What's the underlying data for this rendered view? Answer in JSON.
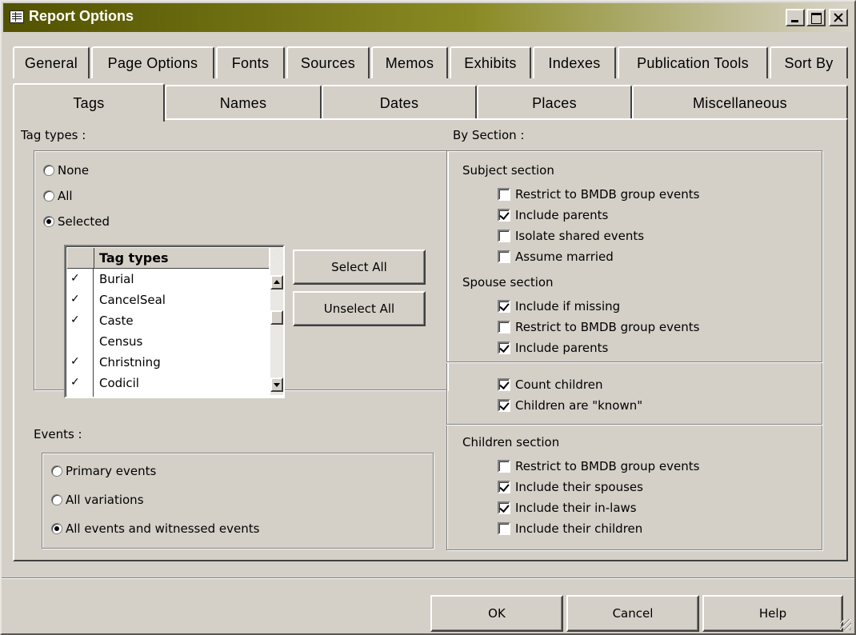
{
  "window": {
    "title": "Report Options",
    "icons": [
      "report-icon",
      "minimize-icon",
      "maximize-icon",
      "close-icon"
    ]
  },
  "tabs_row1": [
    "General",
    "Page Options",
    "Fonts",
    "Sources",
    "Memos",
    "Exhibits",
    "Indexes",
    "Publication Tools",
    "Sort By"
  ],
  "tabs_row2": [
    "Tags",
    "Names",
    "Dates",
    "Places",
    "Miscellaneous"
  ],
  "active_tab": "Tags",
  "tag_types": {
    "label": "Tag types :",
    "radios": [
      {
        "label": "None",
        "selected": false
      },
      {
        "label": "All",
        "selected": false
      },
      {
        "label": "Selected",
        "selected": true
      }
    ],
    "list_header": "Tag types",
    "items": [
      {
        "mark": "✓",
        "name": "Burial"
      },
      {
        "mark": "✓",
        "name": "CancelSeal"
      },
      {
        "mark": "✓",
        "name": "Caste"
      },
      {
        "mark": "",
        "name": "Census"
      },
      {
        "mark": "✓",
        "name": "Christning"
      },
      {
        "mark": "✓",
        "name": "Codicil"
      }
    ],
    "select_all": "Select All",
    "unselect_all": "Unselect All"
  },
  "events": {
    "label": "Events :",
    "radios": [
      {
        "label": "Primary events",
        "selected": false
      },
      {
        "label": "All variations",
        "selected": false
      },
      {
        "label": "All events and witnessed events",
        "selected": true
      }
    ]
  },
  "by_section": {
    "label": "By Section :",
    "subject": {
      "title": "Subject section",
      "options": [
        {
          "label": "Restrict to BMDB group events",
          "checked": false
        },
        {
          "label": "Include parents",
          "checked": true
        },
        {
          "label": "Isolate shared events",
          "checked": false
        },
        {
          "label": "Assume married",
          "checked": false
        }
      ]
    },
    "spouse": {
      "title": "Spouse section",
      "options": [
        {
          "label": "Include if missing",
          "checked": true
        },
        {
          "label": "Restrict to BMDB group events",
          "checked": false
        },
        {
          "label": "Include parents",
          "checked": true
        }
      ]
    },
    "children_count": {
      "options": [
        {
          "label": "Count children",
          "checked": true
        },
        {
          "label": "Children are \"known\"",
          "checked": true
        }
      ]
    },
    "children": {
      "title": "Children section",
      "options": [
        {
          "label": "Restrict to BMDB group events",
          "checked": false
        },
        {
          "label": "Include their spouses",
          "checked": true
        },
        {
          "label": "Include their in-laws",
          "checked": true
        },
        {
          "label": "Include their children",
          "checked": false
        }
      ]
    }
  },
  "footer": {
    "ok": "OK",
    "cancel": "Cancel",
    "help": "Help"
  }
}
